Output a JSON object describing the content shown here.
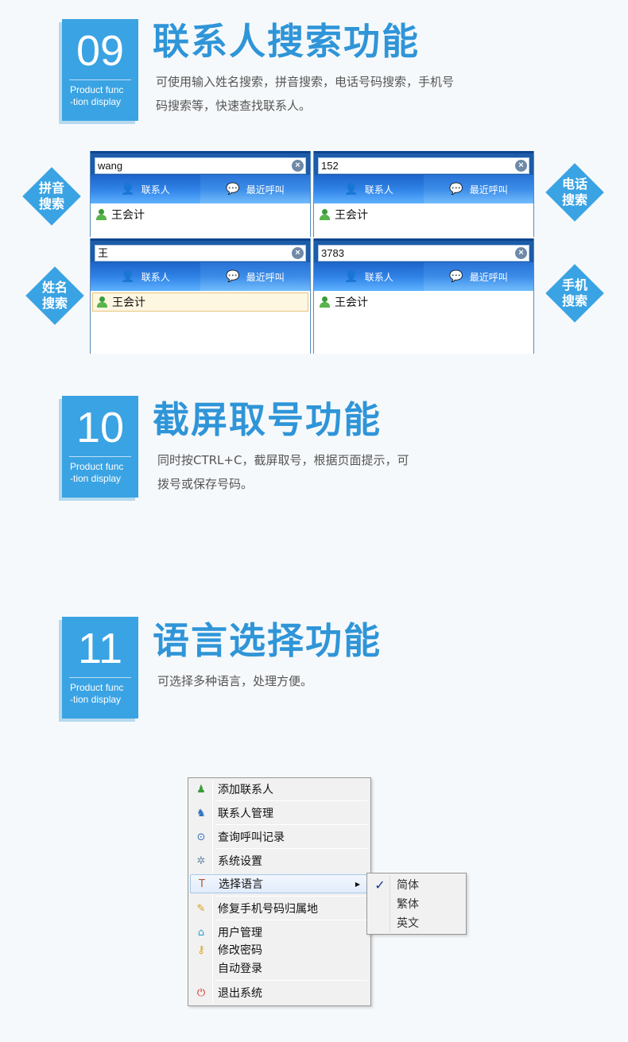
{
  "sections": [
    {
      "number": "09",
      "subtitle_line1": "Product func",
      "subtitle_line2": "-tion display",
      "title": "联系人搜索功能",
      "desc_line1": "可使用输入姓名搜索，拼音搜索，电话号码搜索，手机号",
      "desc_line2": "码搜索等，快速查找联系人。"
    },
    {
      "number": "10",
      "subtitle_line1": "Product func",
      "subtitle_line2": "-tion display",
      "title": "截屏取号功能",
      "desc_line1": "同时按CTRL+C，截屏取号，根据页面提示，可",
      "desc_line2": "拨号或保存号码。"
    },
    {
      "number": "11",
      "subtitle_line1": "Product func",
      "subtitle_line2": "-tion display",
      "title": "语言选择功能",
      "desc_line1": "可选择多种语言，处理方便。",
      "desc_line2": ""
    }
  ],
  "diamonds": {
    "pinyin": [
      "拼音",
      "搜索"
    ],
    "phone": [
      "电话",
      "搜索"
    ],
    "name": [
      "姓名",
      "搜索"
    ],
    "mobile": [
      "手机",
      "搜索"
    ]
  },
  "search_panels": [
    {
      "query": "wang",
      "tab_contacts": "联系人",
      "tab_recent": "最近呼叫",
      "result": "王会计"
    },
    {
      "query": "152",
      "tab_contacts": "联系人",
      "tab_recent": "最近呼叫",
      "result": "王会计"
    },
    {
      "query": "王",
      "tab_contacts": "联系人",
      "tab_recent": "最近呼叫",
      "result": "王会计"
    },
    {
      "query": "3783",
      "tab_contacts": "联系人",
      "tab_recent": "最近呼叫",
      "result": "王会计"
    }
  ],
  "menu": {
    "add_contact": "添加联系人",
    "manage_contacts": "联系人管理",
    "call_records": "查询呼叫记录",
    "settings": "系统设置",
    "language": "选择语言",
    "fix_location": "修复手机号码归属地",
    "user_mgmt": "用户管理",
    "change_pwd": "修改密码",
    "auto_login": "自动登录",
    "exit": "退出系统"
  },
  "submenu": {
    "simplified": "简体",
    "traditional": "繁体",
    "english": "英文"
  },
  "colors": {
    "accent": "#3aa3e3",
    "title": "#2f95d8",
    "panel_header": "#1c5ca8"
  }
}
